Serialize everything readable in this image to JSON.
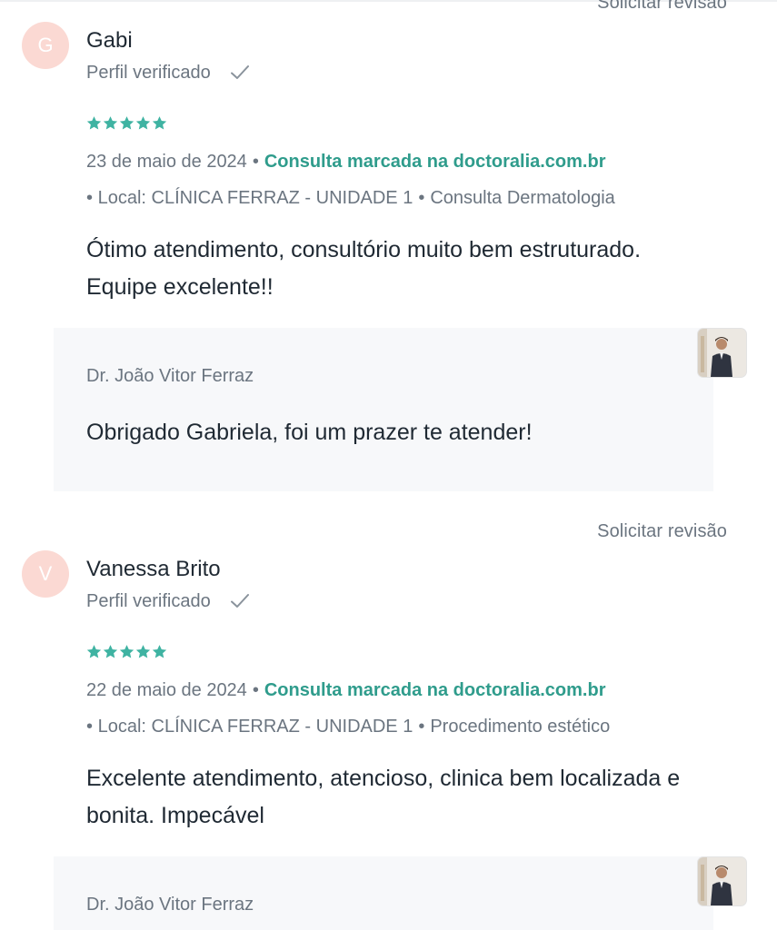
{
  "request_review_label": "Solicitar revisão",
  "reviews": [
    {
      "avatar_letter": "G",
      "author": "Gabi",
      "verified_label": "Perfil verificado",
      "rating": 5,
      "date": "23 de maio de 2024",
      "booked_via": "Consulta marcada na doctoralia.com.br",
      "location": "Local: CLÍNICA FERRAZ - UNIDADE 1",
      "service": "Consulta Dermatologia",
      "comment_line1": "Ótimo atendimento, consultório muito bem estruturado.",
      "comment_line2": "Equipe excelente!!",
      "reply_author": "Dr. João Vitor Ferraz",
      "reply_text": "Obrigado Gabriela, foi um prazer te atender!"
    },
    {
      "avatar_letter": "V",
      "author": "Vanessa Brito",
      "verified_label": "Perfil verificado",
      "rating": 5,
      "date": "22 de maio de 2024",
      "booked_via": "Consulta marcada na doctoralia.com.br",
      "location": "Local: CLÍNICA FERRAZ - UNIDADE 1",
      "service": "Procedimento estético",
      "comment_line1": "Excelente atendimento, atencioso, clinica bem localizada e",
      "comment_line2": "bonita. Impecável",
      "reply_author": "Dr. João Vitor Ferraz",
      "reply_text": ""
    }
  ],
  "colors": {
    "accent_green": "#2f9c8c",
    "star_green": "#3fb3a2",
    "avatar_bg": "#fbd9d3",
    "muted_text": "#6b7580"
  },
  "icons": {
    "verified": "check-icon",
    "rating": "star-icon"
  }
}
